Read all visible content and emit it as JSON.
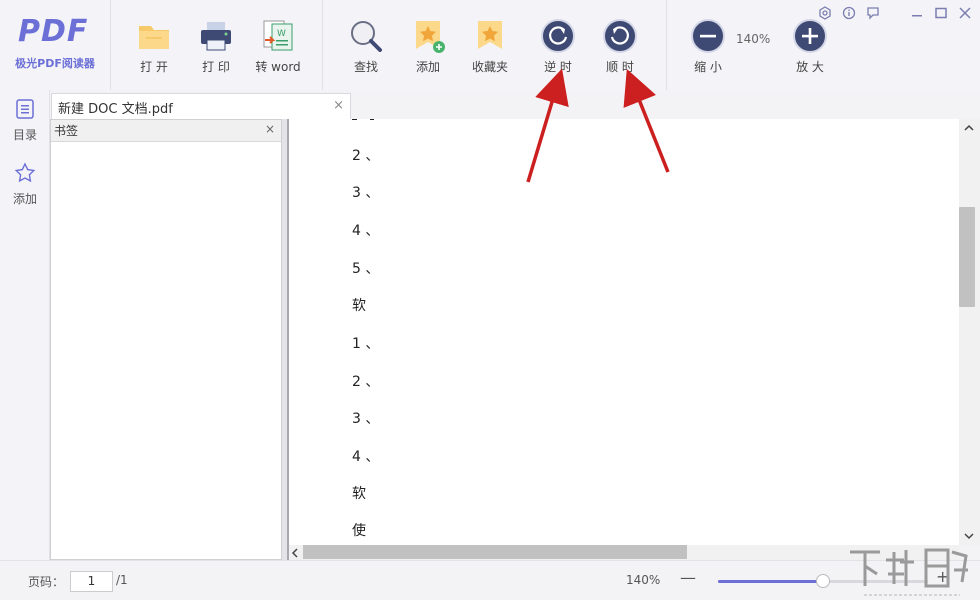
{
  "app": {
    "logo_mark": "PDF",
    "logo_text": "极光PDF阅读器"
  },
  "toolbar": {
    "open_label": "打 开",
    "print_label": "打 印",
    "to_word_label": "转 word",
    "find_label": "查找",
    "add_label": "添加",
    "favorites_label": "收藏夹",
    "rotate_ccw_label": "逆 时",
    "rotate_cw_label": "顺 时",
    "zoom_out_label": "缩 小",
    "zoom_level": "140%",
    "zoom_in_label": "放 大"
  },
  "rail": {
    "toc_label": "目录",
    "add_label": "添加"
  },
  "tab": {
    "title": "新建 DOC 文档.pdf",
    "close": "×"
  },
  "bookmarks": {
    "header": "书签",
    "close": "×"
  },
  "document": {
    "lines": [
      "2 、",
      "3 、",
      "4 、",
      "5 、",
      "软",
      "1 、",
      "2 、",
      "3 、",
      "4 、",
      "软",
      "使"
    ]
  },
  "status": {
    "page_label": "页码：",
    "page_value": "1",
    "page_total": "/1",
    "zoom_level": "140%",
    "zoom_fraction": 0.5
  },
  "colors": {
    "accent": "#6b6fd6",
    "icon_circle": "#3e4a73",
    "folder": "#f6c96a",
    "annotation_arrow": "#cc1f1f"
  },
  "watermark": {
    "text": "下载吧",
    "url": "www.xiazaiba.com"
  }
}
